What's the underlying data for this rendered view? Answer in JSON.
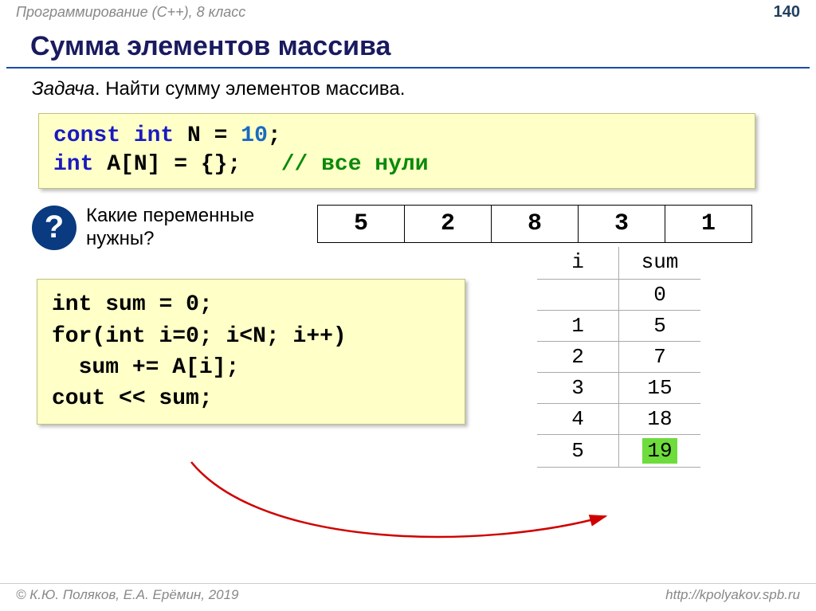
{
  "header": {
    "course": "Программирование (C++), 8 класс",
    "page": "140"
  },
  "title": "Сумма элементов массива",
  "task_label": "Задача",
  "task_text": ". Найти сумму элементов массива.",
  "code1": {
    "const": "const int",
    "var": "N",
    "eq": "=",
    "ten": "10",
    "semi": ";",
    "int": "int",
    "decl": "A[N] = {};",
    "comment": "// все нули"
  },
  "question_text": "Какие переменные нужны?",
  "qmark": "?",
  "array_vals": [
    "5",
    "2",
    "8",
    "3",
    "1"
  ],
  "code2": {
    "l1a": "int",
    "l1b": "sum = ",
    "l1c": "0",
    "l1d": ";",
    "l2a": "for",
    "l2b": "(",
    "l2c": "int",
    "l2d": " i=",
    "l2e": "0",
    "l2f": "; i<N; i++)",
    "l3": "sum += A[i];",
    "l4": "cout << sum;"
  },
  "vartable": {
    "head_i": "i",
    "head_sum": "sum",
    "rows": [
      {
        "i": "",
        "sum": "0"
      },
      {
        "i": "1",
        "sum": "5"
      },
      {
        "i": "2",
        "sum": "7"
      },
      {
        "i": "3",
        "sum": "15"
      },
      {
        "i": "4",
        "sum": "18"
      },
      {
        "i": "5",
        "sum": "19"
      }
    ]
  },
  "footer": {
    "left": "© К.Ю. Поляков, Е.А. Ерёмин, 2019",
    "right": "http://kpolyakov.spb.ru"
  }
}
